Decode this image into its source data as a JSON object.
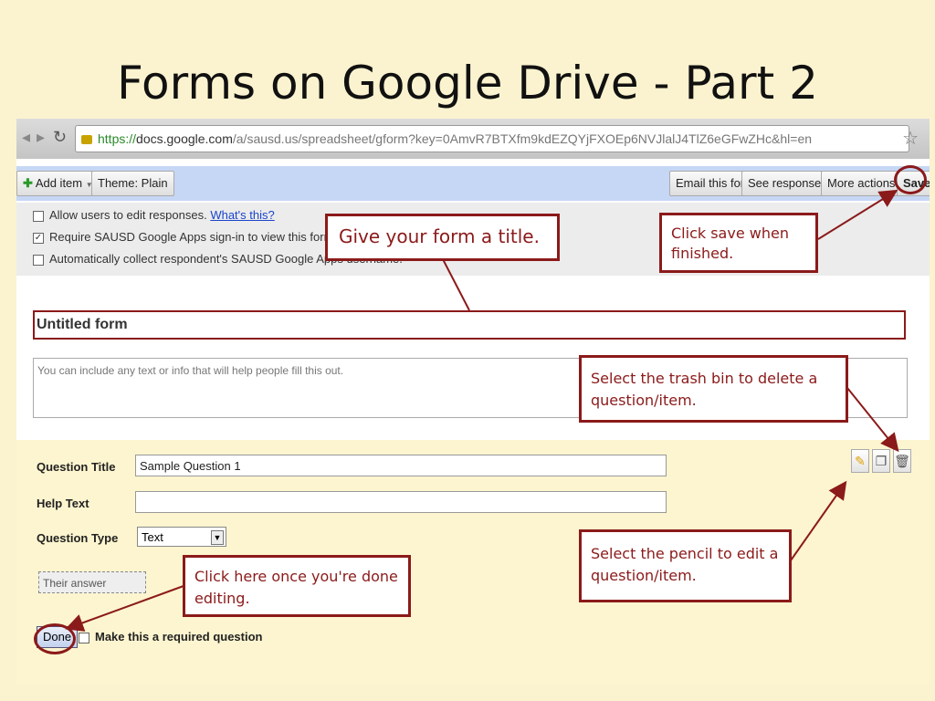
{
  "slide": {
    "title": "Forms on Google Drive - Part 2"
  },
  "browser": {
    "url_scheme": "https://",
    "url_host": "docs.google.com",
    "url_path": "/a/sausd.us/spreadsheet/gform?key=0AmvR7BTXfm9kdEZQYjFXOEp6NVJlalJ4TlZ6eGFwZHc&hl=en"
  },
  "toolbar": {
    "add_item": "Add item",
    "theme": "Theme: Plain",
    "email": "Email this form",
    "see_responses": "See responses",
    "more_actions": "More actions",
    "save": "Save"
  },
  "options": {
    "allow_edit": "Allow users to edit responses.",
    "whats_this": "What's this?",
    "require_signin": "Require SAUSD Google Apps sign-in to view this form.",
    "collect_username": "Automatically collect respondent's SAUSD Google Apps username."
  },
  "form": {
    "title": "Untitled form",
    "description_placeholder": "You can include any text or info that will help people fill this out."
  },
  "question": {
    "title_label": "Question Title",
    "title_value": "Sample Question 1",
    "help_label": "Help Text",
    "help_value": "",
    "type_label": "Question Type",
    "type_value": "Text",
    "answer_placeholder": "Their answer",
    "done": "Done",
    "required_label": "Make this a required question"
  },
  "callouts": {
    "title": "Give your form a title.",
    "save": "Click save when finished.",
    "trash": "Select the trash bin to delete a question/item.",
    "pencil": "Select the pencil to edit a question/item.",
    "done": "Click here once you're done editing."
  },
  "colors": {
    "accent": "#8b1a1a",
    "toolbar": "#c6d7f5",
    "slide_bg": "#fbf3cf"
  }
}
